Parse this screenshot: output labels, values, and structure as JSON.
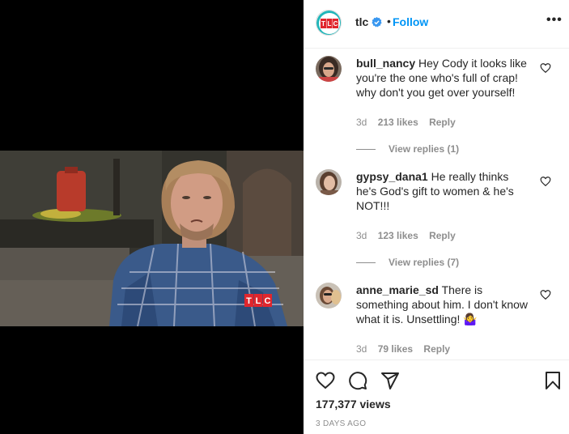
{
  "post": {
    "username": "tlc",
    "follow_label": "Follow",
    "separator": "•",
    "more_label": "•••",
    "views": "177,377 views",
    "date": "3 DAYS AGO",
    "logo_text": "TLC"
  },
  "comments": [
    {
      "username": "bull_nancy",
      "text": "Hey Cody it looks like you're the one who's full of crap! why don't you get over yourself!",
      "age": "3d",
      "likes": "213 likes",
      "reply_label": "Reply",
      "view_replies": "View replies (1)"
    },
    {
      "username": "gypsy_dana1",
      "text": "He really thinks he's God's gift to women & he's NOT!!!",
      "age": "3d",
      "likes": "123 likes",
      "reply_label": "Reply",
      "view_replies": "View replies (7)"
    },
    {
      "username": "anne_marie_sd",
      "text": "There is something about him. I don't know what it is. Unsettling! 🤷‍♀️",
      "age": "3d",
      "likes": "79 likes",
      "reply_label": "Reply",
      "view_replies": ""
    }
  ],
  "icons": {
    "like": "heart-icon",
    "comment": "comment-icon",
    "share": "share-icon",
    "save": "bookmark-icon",
    "verified": "verified-badge-icon",
    "more": "more-options-icon"
  },
  "colors": {
    "accent": "#0095f6",
    "verified": "#3897f0",
    "tlc_red": "#e0262d",
    "tlc_teal": "#20b5b9",
    "muted": "#8e8e8e"
  }
}
